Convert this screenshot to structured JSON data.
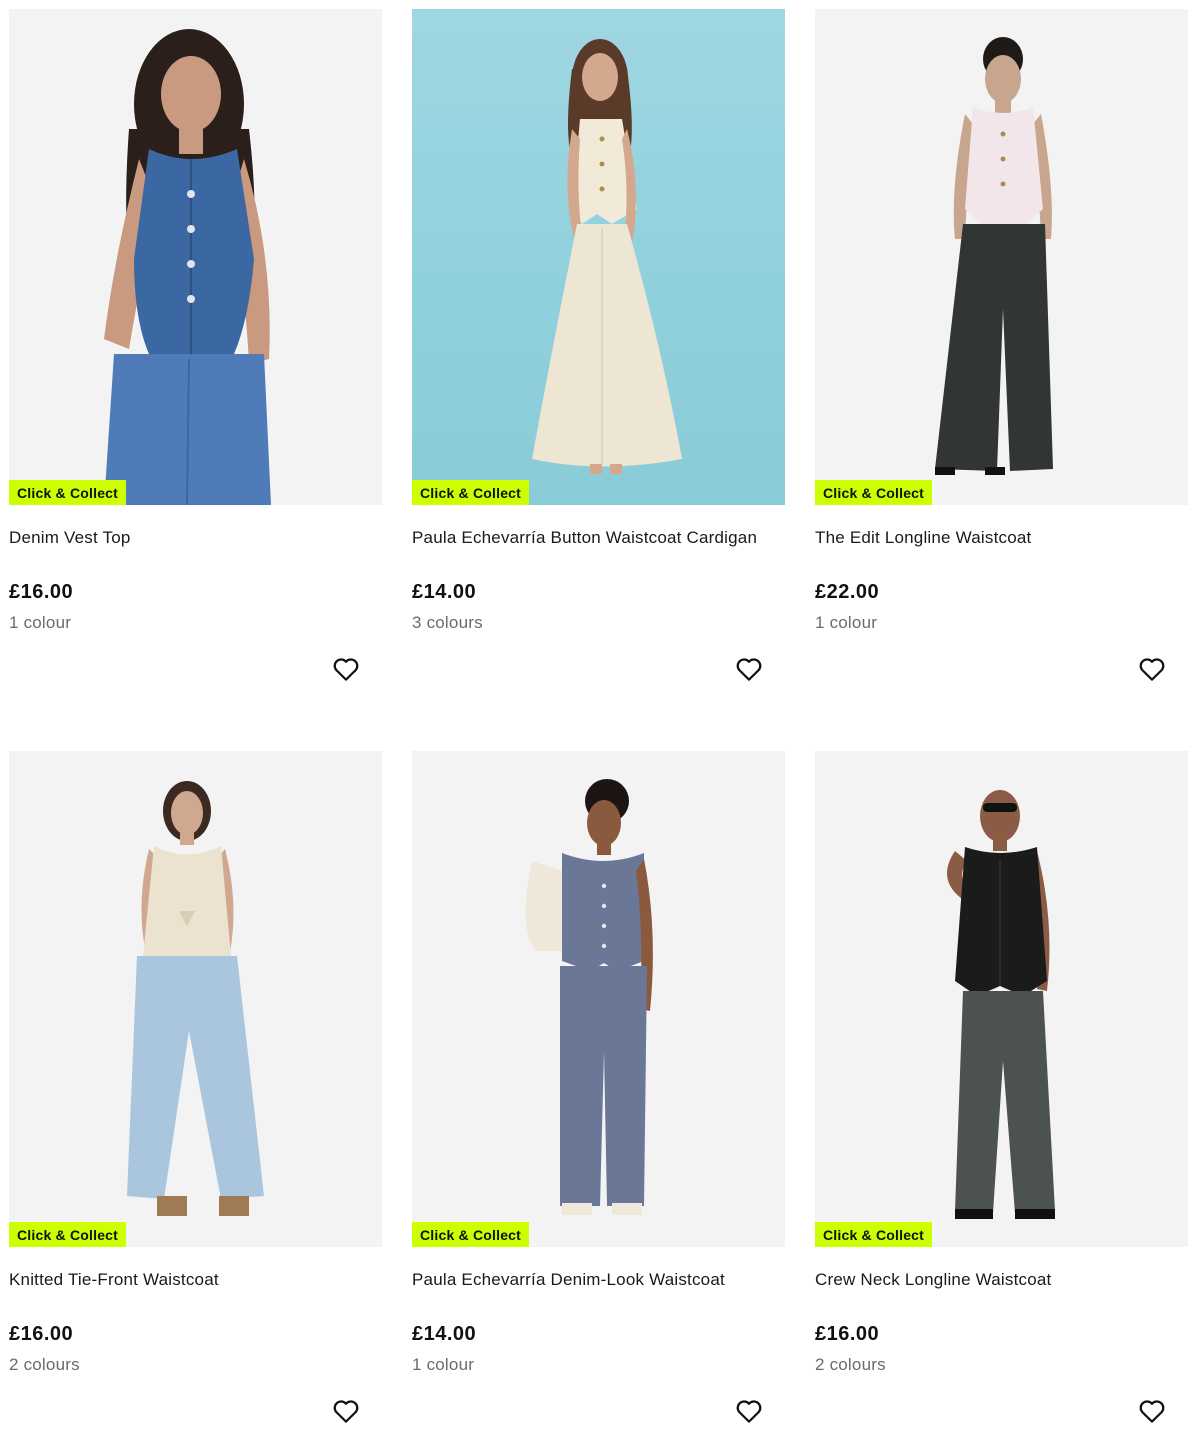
{
  "products": [
    {
      "name": "Denim Vest Top",
      "price": "£16.00",
      "colours": "1 colour",
      "badge": "Click & Collect",
      "favourite_icon": "heart-outline-icon"
    },
    {
      "name": "Paula Echevarría Button Waistcoat Cardigan",
      "price": "£14.00",
      "colours": "3 colours",
      "badge": "Click & Collect",
      "favourite_icon": "heart-outline-icon"
    },
    {
      "name": "The Edit Longline Waistcoat",
      "price": "£22.00",
      "colours": "1 colour",
      "badge": "Click & Collect",
      "favourite_icon": "heart-outline-icon"
    },
    {
      "name": "Knitted Tie-Front Waistcoat",
      "price": "£16.00",
      "colours": "2 colours",
      "badge": "Click & Collect",
      "favourite_icon": "heart-outline-icon"
    },
    {
      "name": "Paula Echevarría Denim-Look Waistcoat",
      "price": "£14.00",
      "colours": "1 colour",
      "badge": "Click & Collect",
      "favourite_icon": "heart-outline-icon"
    },
    {
      "name": "Crew Neck Longline Waistcoat",
      "price": "£16.00",
      "colours": "2 colours",
      "badge": "Click & Collect",
      "favourite_icon": "heart-outline-icon"
    }
  ],
  "colors": {
    "badge_bg": "#ccff00",
    "text": "#1a1a1a",
    "muted": "#6b6b6b",
    "image_bg": "#f3f3f3"
  }
}
